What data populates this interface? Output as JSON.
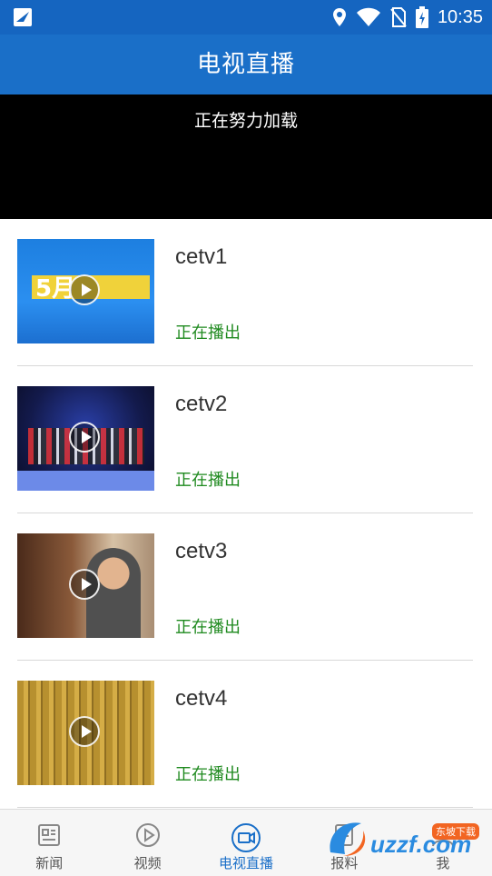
{
  "status_bar": {
    "time": "10:35",
    "icons": [
      "notification-app-icon",
      "location-icon",
      "wifi-icon",
      "no-sim-icon",
      "battery-icon"
    ]
  },
  "header": {
    "title": "电视直播"
  },
  "player": {
    "loading_text": "正在努力加载"
  },
  "channels": [
    {
      "name": "cetv1",
      "status": "正在播出"
    },
    {
      "name": "cetv2",
      "status": "正在播出"
    },
    {
      "name": "cetv3",
      "status": "正在播出"
    },
    {
      "name": "cetv4",
      "status": "正在播出"
    }
  ],
  "bottom_nav": [
    {
      "label": "新闻",
      "icon": "news-icon",
      "active": false
    },
    {
      "label": "视频",
      "icon": "video-play-icon",
      "active": false
    },
    {
      "label": "电视直播",
      "icon": "tv-live-camera-icon",
      "active": true
    },
    {
      "label": "报料",
      "icon": "report-icon",
      "active": false
    },
    {
      "label": "我",
      "icon": "profile-icon",
      "active": false
    }
  ],
  "watermark": {
    "text": "uzzf.com",
    "tag": "东坡下载"
  },
  "colors": {
    "header": "#1a6fc8",
    "status_bar": "#1565c0",
    "live_status": "#1f8a1f",
    "active_tab": "#1a6fc8"
  }
}
